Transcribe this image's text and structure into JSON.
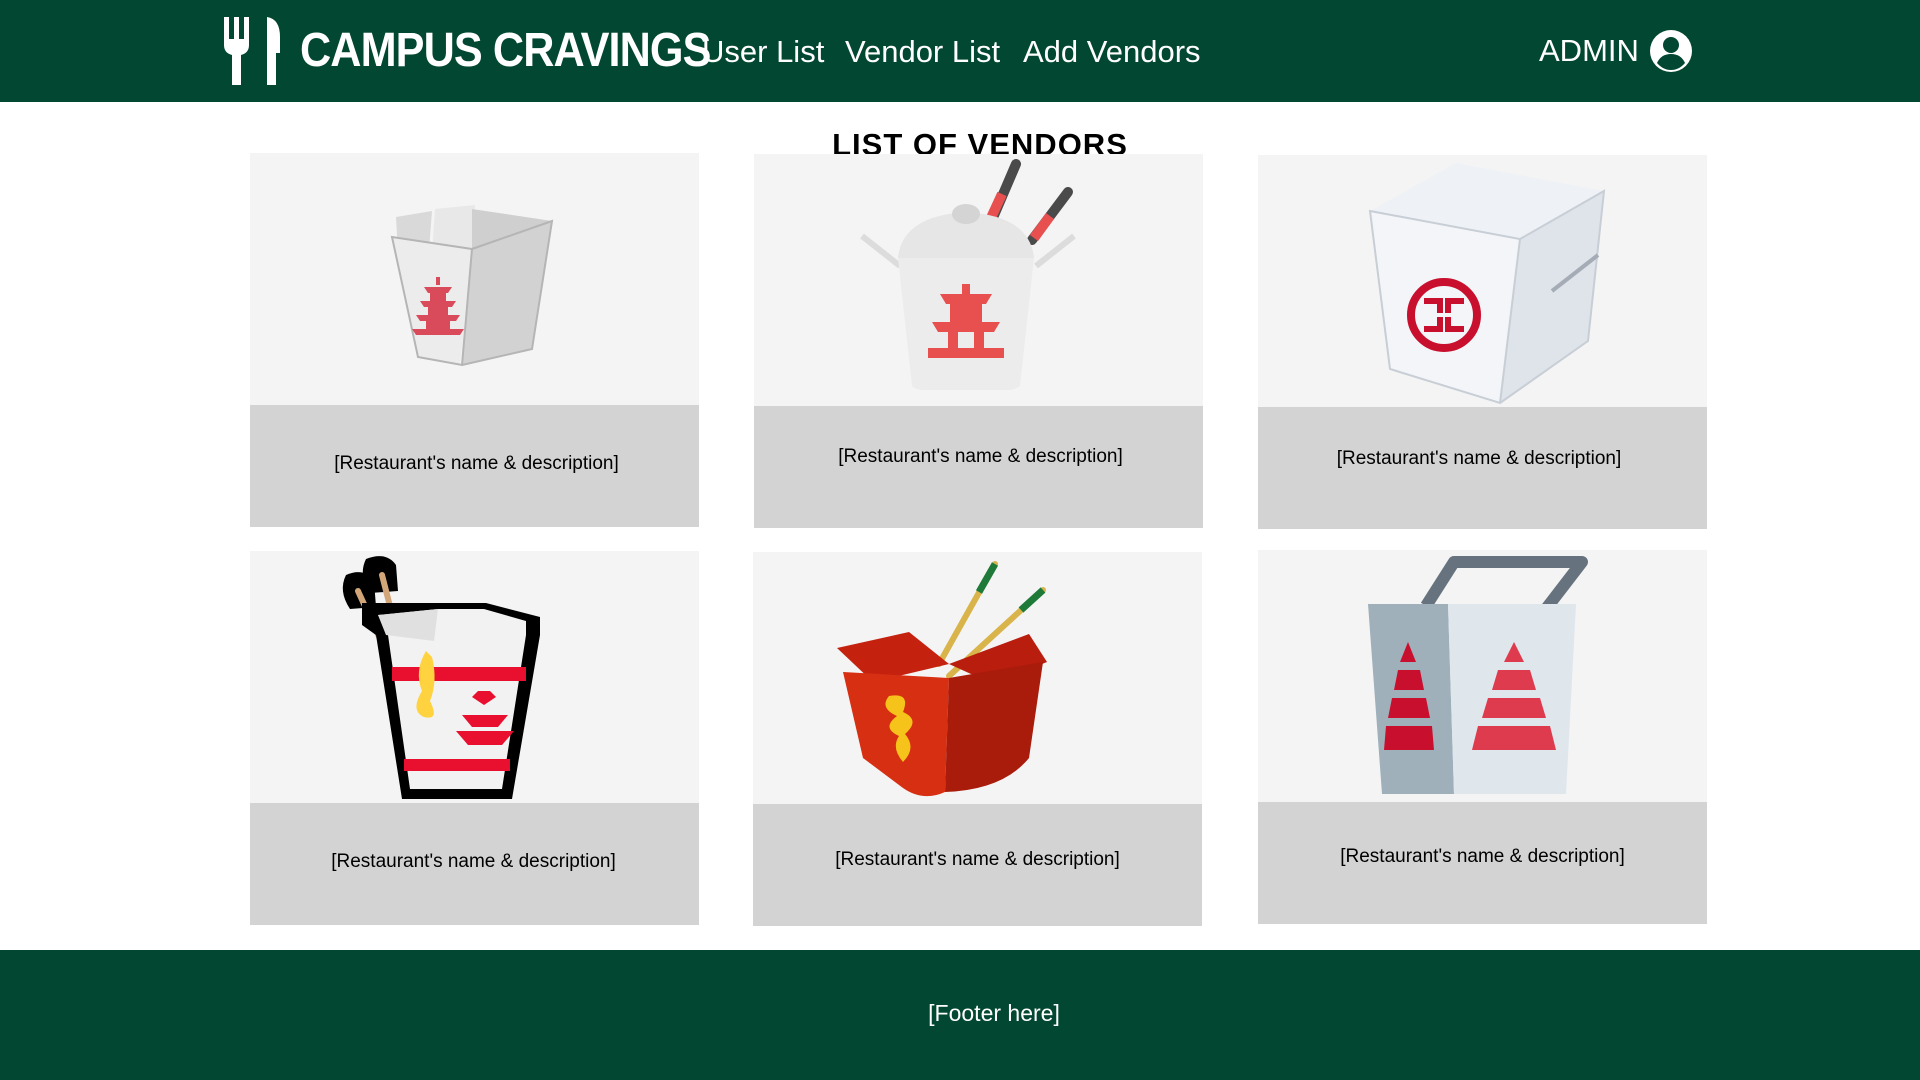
{
  "navbar": {
    "brand": "CAMPUS CRAVINGS",
    "links": [
      "User List",
      "Vendor List",
      "Add Vendors"
    ],
    "user_label": "ADMIN",
    "logo_icon": "fork-knife-icon",
    "user_icon": "user-circle-icon",
    "background_color": "#024731"
  },
  "main": {
    "title": "LIST OF VENDORS",
    "vendors": [
      {
        "image_icon": "takeout-box-pagoda-icon",
        "description": "[Restaurant's name & description]"
      },
      {
        "image_icon": "takeout-box-chopsticks-icon",
        "description": "[Restaurant's name & description]"
      },
      {
        "image_icon": "takeout-box-emblem-icon",
        "description": "[Restaurant's name & description]"
      },
      {
        "image_icon": "noodle-box-icon",
        "description": "[Restaurant's name & description]"
      },
      {
        "image_icon": "dragon-takeout-box-icon",
        "description": "[Restaurant's name & description]"
      },
      {
        "image_icon": "takeout-pail-icon",
        "description": "[Restaurant's name & description]"
      }
    ]
  },
  "footer": {
    "text": "[Footer here]"
  }
}
